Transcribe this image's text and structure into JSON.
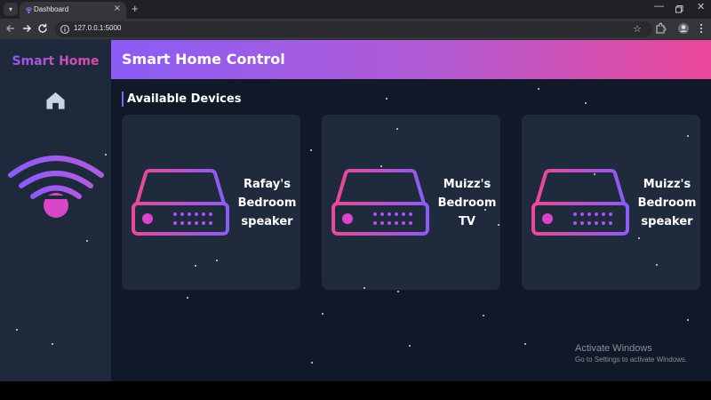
{
  "browser": {
    "tab_title": "Dashboard",
    "url": "127.0.0.1:5000",
    "new_tab_glyph": "+",
    "tab_close_glyph": "×",
    "icons": [
      "tab-search-icon",
      "back-icon",
      "forward-icon",
      "reload-icon",
      "site-info-icon",
      "bookmark-star-icon",
      "extensions-icon",
      "profile-avatar",
      "menu-icon",
      "minimize-icon",
      "maximize-icon",
      "close-window-icon"
    ]
  },
  "app": {
    "brand": "Smart Home",
    "header_title": "Smart Home Control",
    "section_title": "Available Devices",
    "nav_icon": "home-icon",
    "illustration": "wifi-icon",
    "colors": {
      "accent_purple": "#8b5cf6",
      "accent_pink": "#ec4899",
      "sidebar_bg": "#1e293b",
      "content_bg": "#111827",
      "card_bg": "#1f2a3c"
    },
    "devices": [
      {
        "name": "Rafay's Bedroom speaker",
        "icon": "device-hub-icon"
      },
      {
        "name": "Muizz's Bedroom TV",
        "icon": "device-hub-icon"
      },
      {
        "name": "Muizz's Bedroom speaker",
        "icon": "device-hub-icon"
      }
    ]
  },
  "os": {
    "activate_title": "Activate Windows",
    "activate_sub": "Go to Settings to activate Windows."
  }
}
